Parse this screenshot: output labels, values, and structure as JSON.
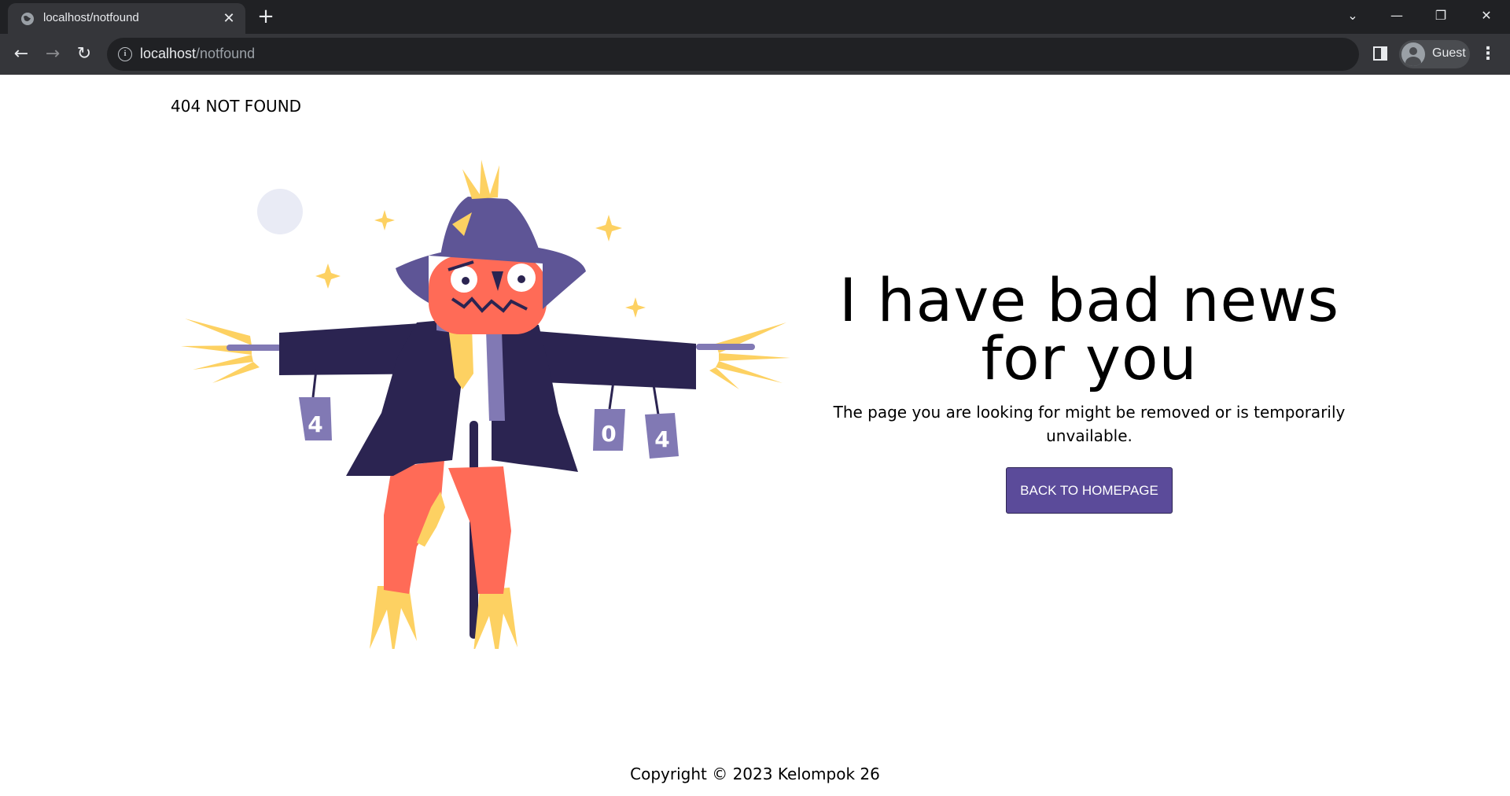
{
  "browser": {
    "tab_title": "localhost/notfound",
    "tab_close": "✕",
    "new_tab": "+",
    "url_host": "localhost",
    "url_path": "/notfound",
    "profile_name": "Guest",
    "window_controls": {
      "dropdown": "⌄",
      "minimize": "—",
      "restore": "❐",
      "close": "✕"
    },
    "nav": {
      "back": "←",
      "forward": "→",
      "reload": "↻",
      "menu": "⋮",
      "info": "i"
    }
  },
  "page": {
    "brand": "404 NOT FOUND",
    "headline_line1": "I have bad news",
    "headline_line2": "for you",
    "subtext": "The page you are looking for might be removed or is temporarily unvailable.",
    "cta_label": "BACK TO HOMEPAGE",
    "footer": "Copyright © 2023 Kelompok 26",
    "cans": [
      "4",
      "0",
      "4"
    ]
  },
  "colors": {
    "accent": "#5b4b9a",
    "scarecrow_coat": "#2b2451",
    "scarecrow_hat": "#5e5596",
    "scarecrow_face": "#ff6b57",
    "straw": "#fdd162",
    "can": "#8179b4",
    "moon": "#e9ebf5"
  }
}
